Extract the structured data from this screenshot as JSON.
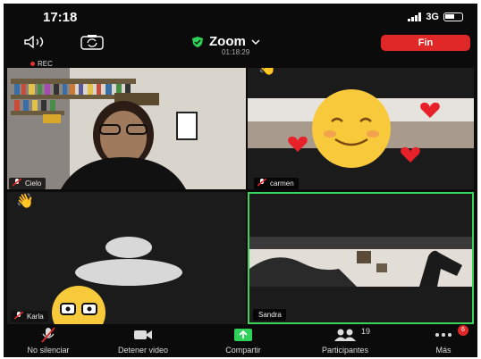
{
  "status_bar": {
    "time": "17:18",
    "network": "3G"
  },
  "meeting": {
    "title": "Zoom",
    "timer": "01:18:29",
    "end_label": "Fin",
    "recording_label": "REC"
  },
  "participants": [
    {
      "name": "Cielo"
    },
    {
      "name": "carmen"
    },
    {
      "name": "Karla"
    },
    {
      "name": "Sandra"
    }
  ],
  "toolbar": {
    "mute_label": "No silenciar",
    "video_label": "Detener video",
    "share_label": "Compartir",
    "participants_label": "Participantes",
    "participants_count": "19",
    "more_label": "Más",
    "more_badge": "6"
  },
  "colors": {
    "end": "#e02828",
    "share": "#2fd15a",
    "active_speaker": "#3bd45a",
    "background": "#0b0b0b"
  },
  "icons": [
    "speaker-icon",
    "camera-flip-icon",
    "shield-icon",
    "chevron-down-icon",
    "muted-mic-icon",
    "raised-hand-icon",
    "share-icon",
    "video-icon",
    "participants-icon",
    "more-icon"
  ]
}
